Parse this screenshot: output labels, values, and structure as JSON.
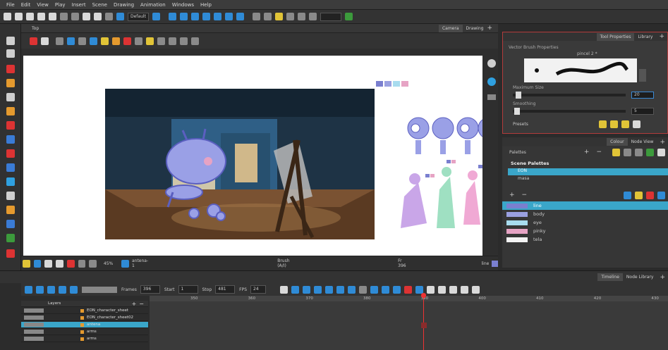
{
  "menu": [
    "File",
    "Edit",
    "View",
    "Play",
    "Insert",
    "Scene",
    "Drawing",
    "Animation",
    "Windows",
    "Help"
  ],
  "toolbar": {
    "workspace": "Default"
  },
  "camera": {
    "tabs": [
      "Top",
      "Camera",
      "Drawing"
    ],
    "status": {
      "zoom": "45%",
      "layer": "antena-1",
      "brush": "Brush (A/I)",
      "frame": "Fr 396",
      "color": "line"
    }
  },
  "tool_properties": {
    "tabs": [
      "Tool Properties",
      "Library"
    ],
    "title": "Vector Brush Properties",
    "preset": "pincel 2 *",
    "max_size_label": "Maximum Size",
    "max_size_value": "20",
    "smoothing_label": "Smoothing",
    "smoothing_value": "5",
    "presets_label": "Presets"
  },
  "colour": {
    "tabs": [
      "Colour",
      "Node View"
    ],
    "palette_label": "Palettes",
    "scene_palettes": "Scene Palettes",
    "palettes": [
      "EON",
      "masa"
    ],
    "swatches": [
      {
        "name": "line",
        "color": "#7a7fcf",
        "selected": true
      },
      {
        "name": "body",
        "color": "#9aa0e0",
        "selected": false
      },
      {
        "name": "eye",
        "color": "#a8dcef",
        "selected": false
      },
      {
        "name": "pinky",
        "color": "#e6a3c4",
        "selected": false
      },
      {
        "name": "tela",
        "color": "#f3f3f3",
        "selected": false
      }
    ]
  },
  "timeline": {
    "tabs": [
      "Timeline",
      "Node Library"
    ],
    "frames_label": "Frames",
    "frames_value": "396",
    "start_label": "Start",
    "start_value": "1",
    "stop_label": "Stop",
    "stop_value": "481",
    "fps_label": "FPS",
    "fps_value": "24",
    "layers_label": "Layers",
    "layers": [
      "EON_character_sheet",
      "EON_character_sheet02",
      "antena",
      "arms",
      "arms"
    ],
    "ruler": [
      "350",
      "360",
      "370",
      "380",
      "390",
      "400",
      "410",
      "420",
      "430"
    ]
  }
}
